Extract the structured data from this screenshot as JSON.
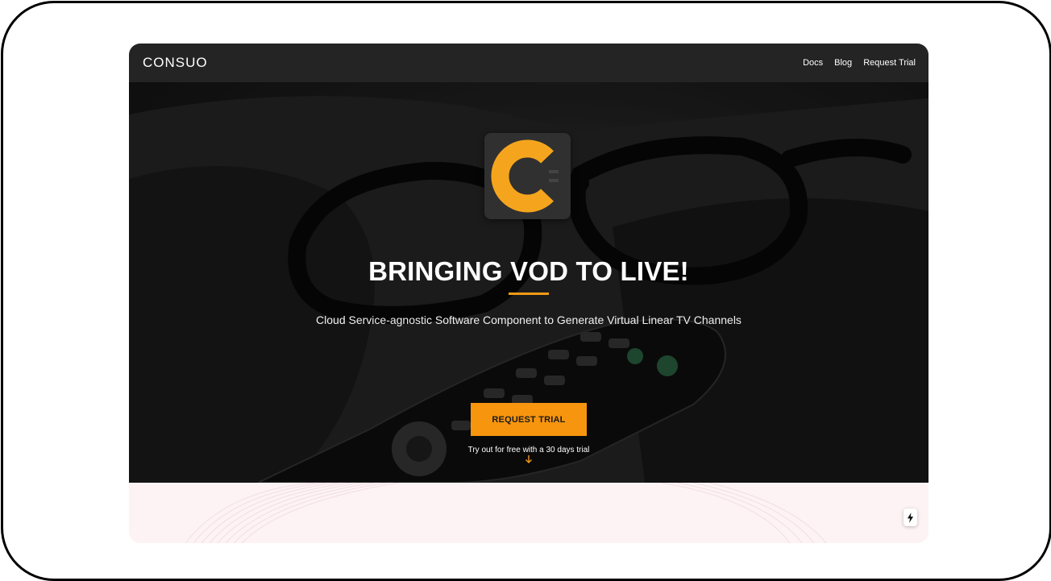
{
  "navbar": {
    "brand": "CONSUO",
    "links": [
      "Docs",
      "Blog",
      "Request Trial"
    ]
  },
  "hero": {
    "logo_icon": "consuo-c-logo-icon",
    "title": "BRINGING VOD TO LIVE!",
    "subtitle": "Cloud Service-agnostic Software Component to Generate Virtual Linear TV Channels",
    "cta_label": "REQUEST TRIAL",
    "cta_note": "Try out for free with a 30 days trial",
    "scroll_icon": "arrow-down-icon"
  },
  "widget": {
    "icon": "bolt-icon"
  },
  "colors": {
    "accent": "#f7950e",
    "navbar": "#242424",
    "lower_section": "#fdf3f5"
  }
}
